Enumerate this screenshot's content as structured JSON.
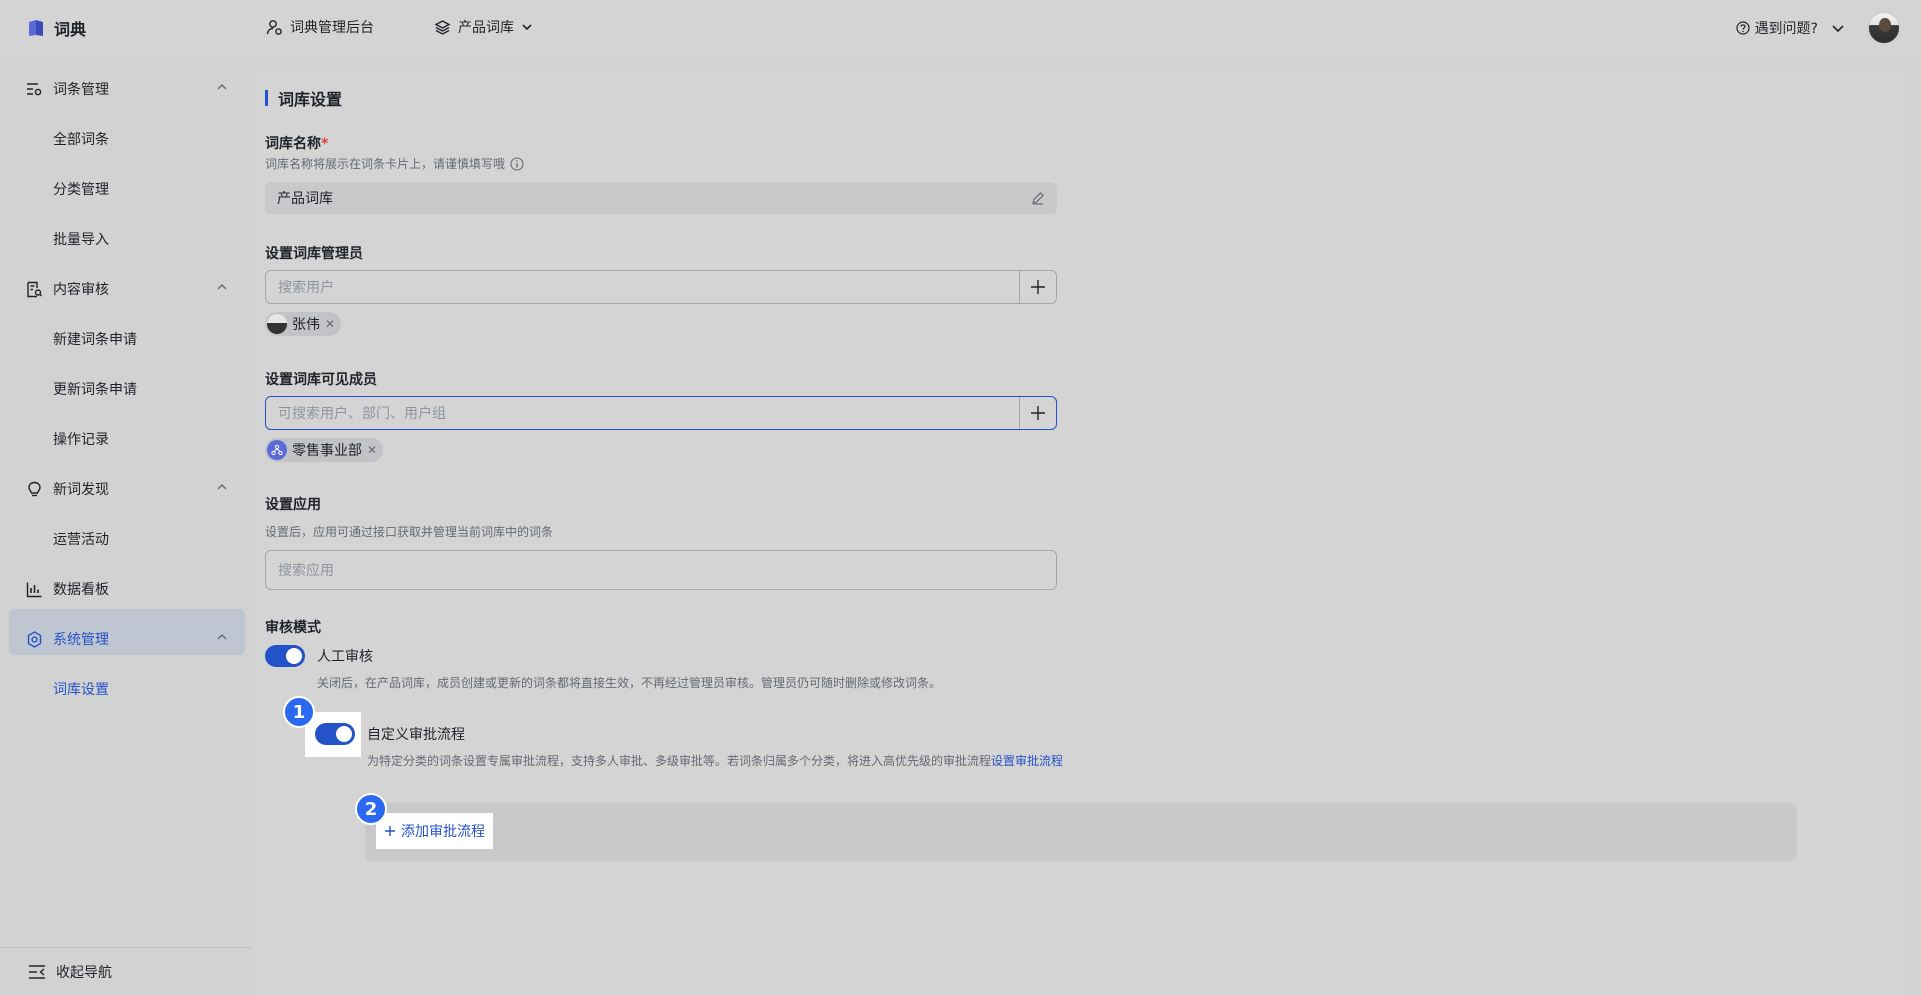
{
  "brand": {
    "name": "词典"
  },
  "topnav": {
    "admin_label": "词典管理后台",
    "library_label": "产品词库",
    "help_label": "遇到问题?"
  },
  "sidebar": {
    "groups": [
      {
        "label": "词条管理",
        "items": [
          "全部词条",
          "分类管理",
          "批量导入"
        ]
      },
      {
        "label": "内容审核",
        "items": [
          "新建词条申请",
          "更新词条申请",
          "操作记录"
        ]
      },
      {
        "label": "新词发现",
        "items": [
          "运营活动"
        ]
      },
      {
        "label": "数据看板",
        "items": []
      },
      {
        "label": "系统管理",
        "items": [
          "词库设置"
        ]
      }
    ],
    "collapse_label": "收起导航"
  },
  "page": {
    "title": "词库设置",
    "name_label": "词库名称",
    "name_required": "*",
    "name_hint": "词库名称将展示在词条卡片上，请谨慎填写哦",
    "name_value": "产品词库",
    "admin_label": "设置词库管理员",
    "admin_placeholder": "搜索用户",
    "admin_tag": "张伟",
    "members_label": "设置词库可见成员",
    "members_placeholder": "可搜索用户、部门、用户组",
    "members_tag": "零售事业部",
    "app_label": "设置应用",
    "app_hint": "设置后，应用可通过接口获取并管理当前词库中的词条",
    "app_placeholder": "搜索应用",
    "review_label": "审核模式",
    "manual_title": "人工审核",
    "manual_desc": "关闭后，在产品词库，成员创建或更新的词条都将直接生效，不再经过管理员审核。管理员仍可随时删除或修改词条。",
    "custom_title": "自定义审批流程",
    "custom_desc": "为特定分类的词条设置专属审批流程，支持多人审批、多级审批等。若词条归属多个分类，将进入高优先级的审批流程",
    "custom_link": "设置审批流程",
    "add_flow": "添加审批流程"
  },
  "annotations": {
    "step1": "1",
    "step2": "2"
  },
  "colors": {
    "accent": "#2452c8",
    "badge": "#2b6af0",
    "required": "#e33b3b"
  }
}
